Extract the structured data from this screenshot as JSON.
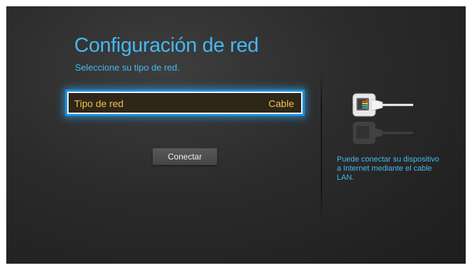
{
  "screen": {
    "title": "Configuración de red",
    "subtitle": "Seleccione su tipo de red."
  },
  "network_type": {
    "label": "Tipo de red",
    "value": "Cable"
  },
  "connect_button": {
    "label": "Conectar"
  },
  "help": {
    "icon": "lan-cable-icon",
    "text": "Puede conectar su dispositivo a Internet mediante el cable LAN."
  },
  "colors": {
    "accent": "#45b8f0",
    "highlight_text": "#f2c14e",
    "focus_glow": "#1f8fd6",
    "background": "#2b2b2b"
  }
}
